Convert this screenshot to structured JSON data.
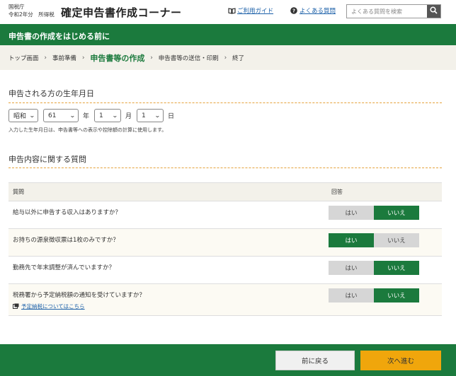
{
  "header": {
    "agency_line1": "国税庁",
    "agency_line2": "令和2年分　所得税",
    "title": "確定申告書作成コーナー",
    "guide_link": "ご利用ガイド",
    "faq_link": "よくある質問",
    "search_placeholder": "よくある質問を検索"
  },
  "banner": {
    "title": "申告書の作成をはじめる前に"
  },
  "breadcrumb": {
    "items": [
      "トップ画面",
      "事前準備",
      "申告書等の作成",
      "申告書等の送信・印刷",
      "終了"
    ],
    "current_index": 2
  },
  "birth": {
    "section_title": "申告される方の生年月日",
    "era": "昭和",
    "year": "61",
    "year_unit": "年",
    "month": "1",
    "month_unit": "月",
    "day": "1",
    "day_unit": "日",
    "note": "入力した生年月日は、申告書等への表示や控除額の計算に使用します。"
  },
  "questions": {
    "section_title": "申告内容に関する質問",
    "col_question": "質問",
    "col_answer": "回答",
    "yes_label": "はい",
    "no_label": "いいえ",
    "rows": [
      {
        "text": "給与以外に申告する収入はありますか？",
        "selected": "no"
      },
      {
        "text": "お持ちの源泉徴収票は1枚のみですか？",
        "selected": "yes"
      },
      {
        "text": "勤務先で年末調整が済んでいますか？",
        "selected": "no"
      },
      {
        "text": "税務署から予定納税額の通知を受けていますか？",
        "selected": "no",
        "link": "予定納税についてはこちら"
      }
    ]
  },
  "footer": {
    "back_label": "前に戻る",
    "next_label": "次へ進む"
  },
  "colors": {
    "brand_green": "#1b7a3d",
    "next_orange": "#f0a60c",
    "link_blue": "#1a5fa8"
  }
}
